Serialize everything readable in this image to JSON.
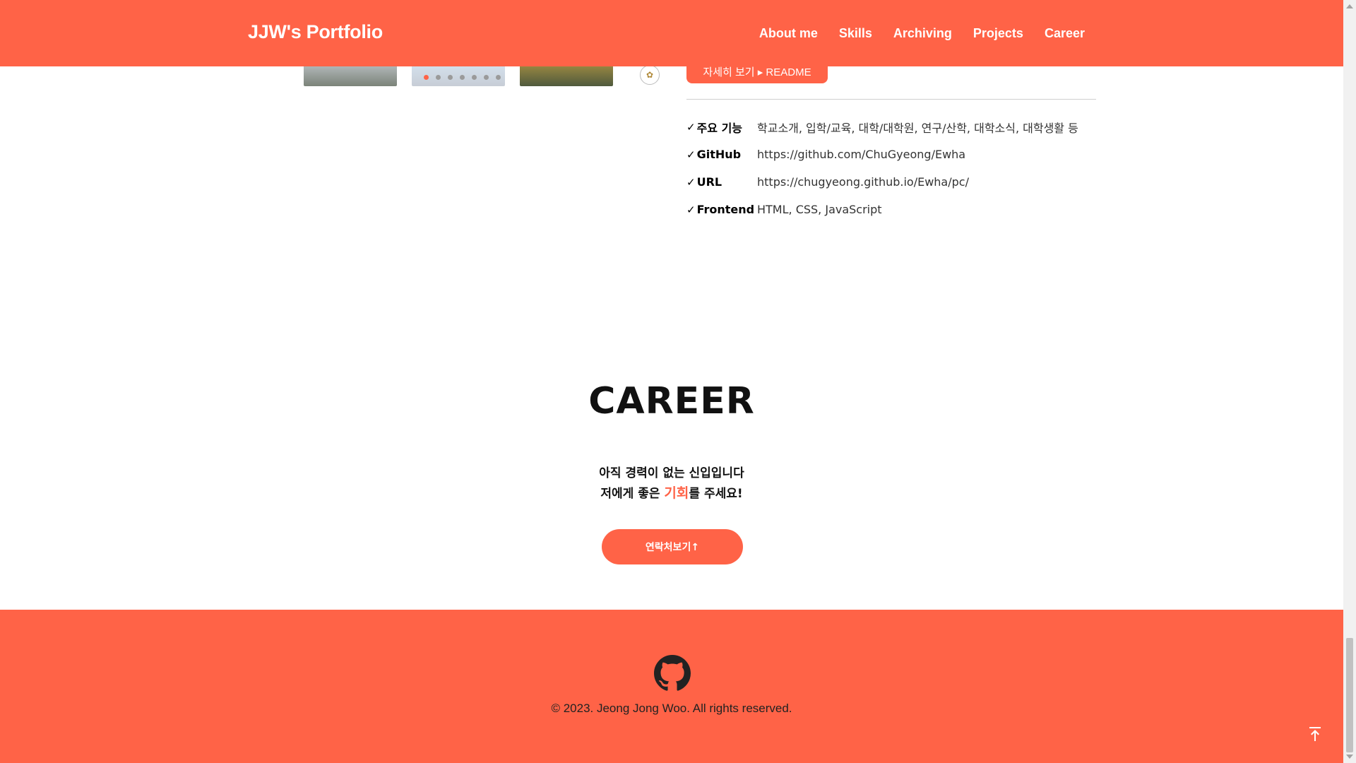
{
  "header": {
    "brand": "JJW's Portfolio",
    "nav": [
      "About me",
      "Skills",
      "Archiving",
      "Projects",
      "Career"
    ]
  },
  "project": {
    "detail_button": "자세히 보기 ▸ README",
    "info": [
      {
        "key": "주요 기능",
        "value": "학교소개, 입학/교육, 대학/대학원, 연구/산학, 대학소식, 대학생활 등"
      },
      {
        "key": "GitHub",
        "value": "https://github.com/ChuGyeong/Ewha"
      },
      {
        "key": "URL",
        "value": "https://chugyeong.github.io/Ewha/pc/"
      },
      {
        "key": "Frontend",
        "value": "HTML, CSS, JavaScript"
      }
    ]
  },
  "career": {
    "title": "CAREER",
    "line1": "아직 경력이 없는 신입입니다",
    "line2_prefix": "저에게 좋은 ",
    "line2_accent": "기회",
    "line2_suffix": "를 주세요!",
    "contact_label": "연락처보기↑"
  },
  "footer": {
    "copyright": "© 2023. Jeong Jong Woo. All rights reserved."
  },
  "colors": {
    "accent": "#ff6347"
  },
  "icons": [
    "check-icon",
    "github-icon",
    "scroll-to-top-icon"
  ]
}
